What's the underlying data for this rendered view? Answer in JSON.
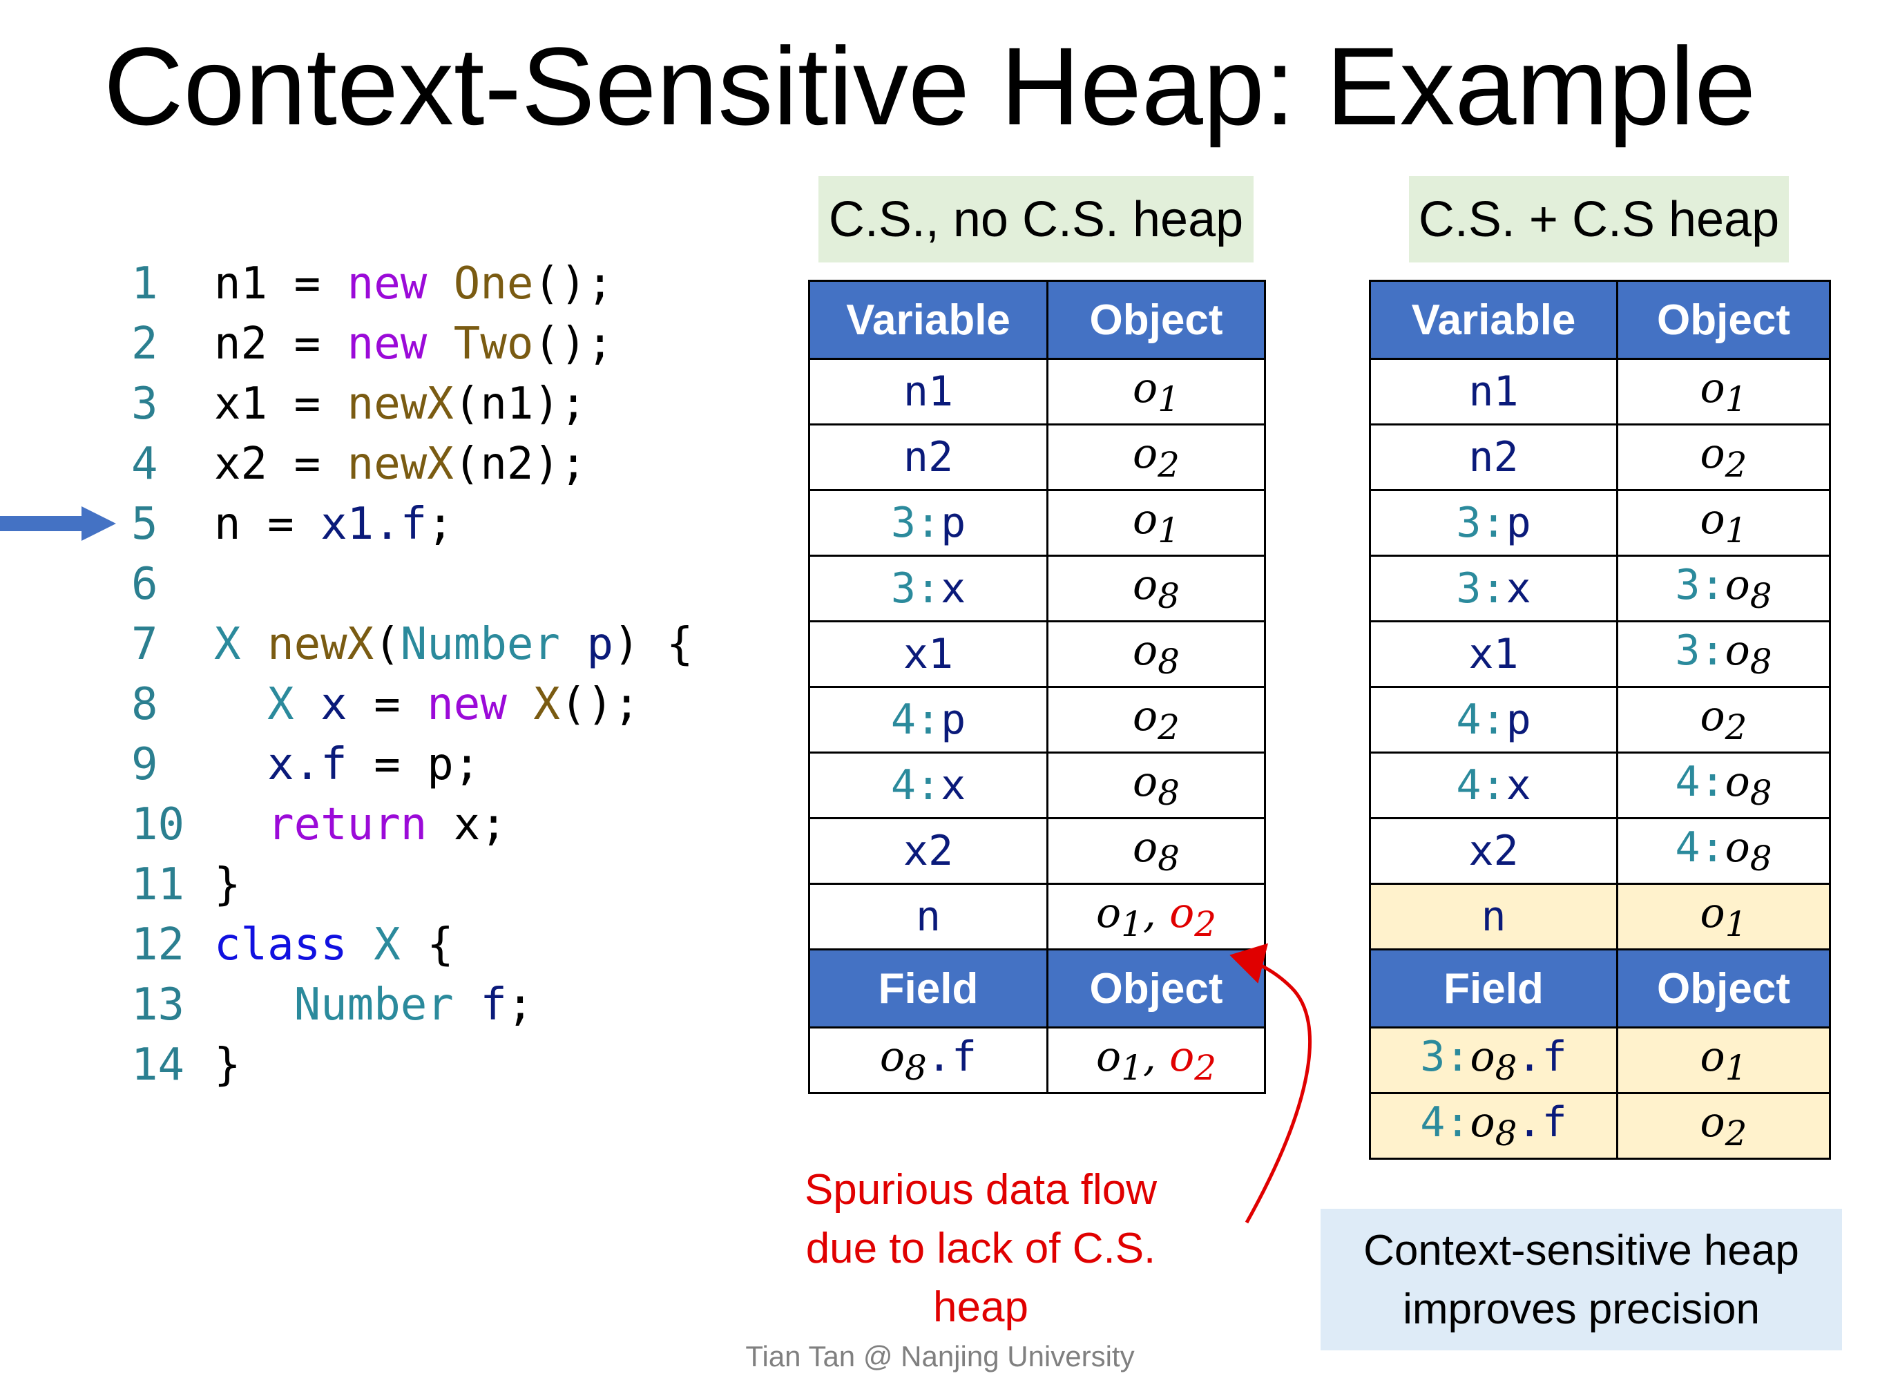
{
  "title": "Context-Sensitive Heap: Example",
  "code": [
    {
      "num": "1",
      "parts": [
        [
          "n1 = ",
          ""
        ],
        [
          "new",
          "kw"
        ],
        [
          " ",
          ""
        ],
        [
          "One",
          "ty"
        ],
        [
          "();",
          ""
        ]
      ]
    },
    {
      "num": "2",
      "parts": [
        [
          "n2 = ",
          ""
        ],
        [
          "new",
          "kw"
        ],
        [
          " ",
          ""
        ],
        [
          "Two",
          "ty"
        ],
        [
          "();",
          ""
        ]
      ]
    },
    {
      "num": "3",
      "parts": [
        [
          "x1 = ",
          ""
        ],
        [
          "newX",
          "ty"
        ],
        [
          "(n1);",
          ""
        ]
      ]
    },
    {
      "num": "4",
      "parts": [
        [
          "x2 = ",
          ""
        ],
        [
          "newX",
          "ty"
        ],
        [
          "(n2);",
          ""
        ]
      ]
    },
    {
      "num": "5",
      "parts": [
        [
          "n = ",
          ""
        ],
        [
          "x1.f",
          "nv"
        ],
        [
          ";",
          ""
        ]
      ]
    },
    {
      "num": "6",
      "parts": []
    },
    {
      "num": "7",
      "parts": [
        [
          "X",
          "tl"
        ],
        [
          " ",
          ""
        ],
        [
          "newX",
          "ty"
        ],
        [
          "(",
          ""
        ],
        [
          "Number",
          "tl"
        ],
        [
          " ",
          ""
        ],
        [
          "p",
          "nv"
        ],
        [
          ") {",
          ""
        ]
      ]
    },
    {
      "num": "8",
      "parts": [
        [
          "  ",
          ""
        ],
        [
          "X",
          "tl"
        ],
        [
          " ",
          ""
        ],
        [
          "x",
          "nv"
        ],
        [
          " = ",
          ""
        ],
        [
          "new",
          "kw"
        ],
        [
          " ",
          ""
        ],
        [
          "X",
          "ty"
        ],
        [
          "();",
          ""
        ]
      ]
    },
    {
      "num": "9",
      "parts": [
        [
          "  ",
          ""
        ],
        [
          "x.f",
          "nv"
        ],
        [
          " = p;",
          ""
        ]
      ]
    },
    {
      "num": "10",
      "parts": [
        [
          "  ",
          ""
        ],
        [
          "return",
          "kw"
        ],
        [
          " x;",
          ""
        ]
      ]
    },
    {
      "num": "11",
      "parts": [
        [
          "}",
          ""
        ]
      ]
    },
    {
      "num": "12",
      "parts": [
        [
          "class",
          "kb"
        ],
        [
          " ",
          ""
        ],
        [
          "X",
          "tl"
        ],
        [
          " {",
          ""
        ]
      ]
    },
    {
      "num": "13",
      "parts": [
        [
          "   ",
          ""
        ],
        [
          "Number",
          "tl"
        ],
        [
          " ",
          ""
        ],
        [
          "f",
          "nv"
        ],
        [
          ";",
          ""
        ]
      ]
    },
    {
      "num": "14",
      "parts": [
        [
          "}",
          ""
        ]
      ]
    }
  ],
  "left_table": {
    "header": "C.S., no C.S. heap",
    "col_variable": "Variable",
    "col_object": "Object",
    "rows": [
      {
        "ctx": "",
        "var": "n1",
        "obj_ctx": "",
        "obj": "o",
        "sub": "1"
      },
      {
        "ctx": "",
        "var": "n2",
        "obj_ctx": "",
        "obj": "o",
        "sub": "2"
      },
      {
        "ctx": "3:",
        "var": "p",
        "obj_ctx": "",
        "obj": "o",
        "sub": "1"
      },
      {
        "ctx": "3:",
        "var": "x",
        "obj_ctx": "",
        "obj": "o",
        "sub": "8"
      },
      {
        "ctx": "",
        "var": "x1",
        "obj_ctx": "",
        "obj": "o",
        "sub": "8"
      },
      {
        "ctx": "4:",
        "var": "p",
        "obj_ctx": "",
        "obj": "o",
        "sub": "2"
      },
      {
        "ctx": "4:",
        "var": "x",
        "obj_ctx": "",
        "obj": "o",
        "sub": "8"
      },
      {
        "ctx": "",
        "var": "x2",
        "obj_ctx": "",
        "obj": "o",
        "sub": "8"
      }
    ],
    "n_row": {
      "var": "n",
      "obj1": "o",
      "sub1": "1",
      "sep": ", ",
      "obj2": "o",
      "sub2": "2"
    },
    "col_field": "Field",
    "field_rows": [
      {
        "ctx": "",
        "obj": "o",
        "sub": "8",
        "field": ".f",
        "val1": "o",
        "vsub1": "1",
        "sep": ", ",
        "val2": "o",
        "vsub2": "2"
      }
    ]
  },
  "right_table": {
    "header": "C.S. + C.S heap",
    "col_variable": "Variable",
    "col_object": "Object",
    "rows": [
      {
        "ctx": "",
        "var": "n1",
        "obj_ctx": "",
        "obj": "o",
        "sub": "1"
      },
      {
        "ctx": "",
        "var": "n2",
        "obj_ctx": "",
        "obj": "o",
        "sub": "2"
      },
      {
        "ctx": "3:",
        "var": "p",
        "obj_ctx": "",
        "obj": "o",
        "sub": "1"
      },
      {
        "ctx": "3:",
        "var": "x",
        "obj_ctx": "3:",
        "obj": "o",
        "sub": "8"
      },
      {
        "ctx": "",
        "var": "x1",
        "obj_ctx": "3:",
        "obj": "o",
        "sub": "8"
      },
      {
        "ctx": "4:",
        "var": "p",
        "obj_ctx": "",
        "obj": "o",
        "sub": "2"
      },
      {
        "ctx": "4:",
        "var": "x",
        "obj_ctx": "4:",
        "obj": "o",
        "sub": "8"
      },
      {
        "ctx": "",
        "var": "x2",
        "obj_ctx": "4:",
        "obj": "o",
        "sub": "8"
      }
    ],
    "n_row": {
      "var": "n",
      "obj1": "o",
      "sub1": "1"
    },
    "col_field": "Field",
    "field_rows": [
      {
        "ctx": "3:",
        "obj": "o",
        "sub": "8",
        "field": ".f",
        "val1": "o",
        "vsub1": "1"
      },
      {
        "ctx": "4:",
        "obj": "o",
        "sub": "8",
        "field": ".f",
        "val1": "o",
        "vsub1": "2"
      }
    ]
  },
  "spurious_note": [
    "Spurious data flow",
    "due to lack of C.S. heap"
  ],
  "precision_note": [
    "Context-sensitive heap",
    "improves precision"
  ],
  "footer": "Tian Tan @ Nanjing University",
  "colors": {
    "header_blue": "#4472c4",
    "highlight": "#fff2cc",
    "red": "#e00000",
    "green_box": "#e2efda",
    "blue_box": "#deebf7"
  }
}
